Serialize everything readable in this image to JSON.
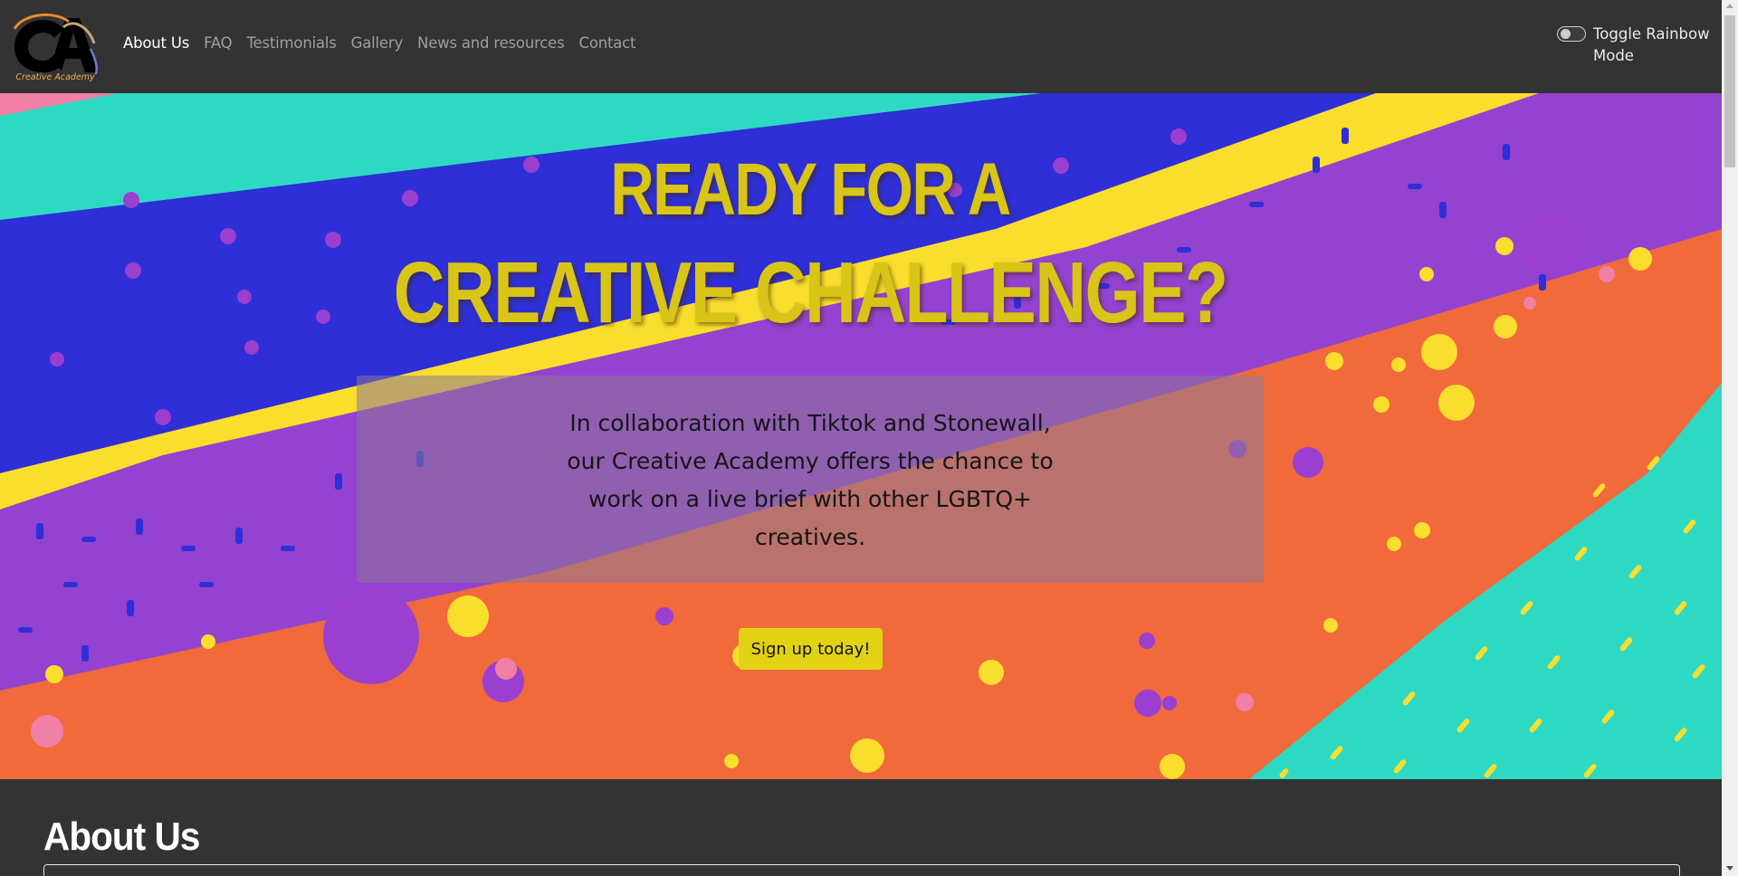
{
  "logo": {
    "text": "Creative Academy",
    "icon": "creative-academy-logo"
  },
  "nav": {
    "items": [
      {
        "label": "About Us",
        "active": true
      },
      {
        "label": "FAQ",
        "active": false
      },
      {
        "label": "Testimonials",
        "active": false
      },
      {
        "label": "Gallery",
        "active": false
      },
      {
        "label": "News and resources",
        "active": false
      },
      {
        "label": "Contact",
        "active": false
      }
    ]
  },
  "toggle": {
    "label": "Toggle Rainbow Mode",
    "checked": false
  },
  "hero": {
    "title_line1": "READY FOR A",
    "title_line2": "CREATIVE CHALLENGE?",
    "description": "In collaboration with Tiktok and Stonewall, our Creative Academy offers the chance to work on a live brief with other LGBTQ+ creatives.",
    "button_label": "Sign up today!"
  },
  "about": {
    "heading": "About Us"
  },
  "colors": {
    "background": "#333334",
    "nav_active": "#ffffff",
    "nav_inactive": "#9f9fa3",
    "title_yellow": "#d8c518",
    "button_yellow": "#e2d214",
    "stripe_teal": "#2ed9c4",
    "stripe_blue": "#2e2fd6",
    "stripe_purple": "#9442d0",
    "stripe_yellow": "#f9de2e",
    "stripe_orange": "#f06a3c"
  }
}
